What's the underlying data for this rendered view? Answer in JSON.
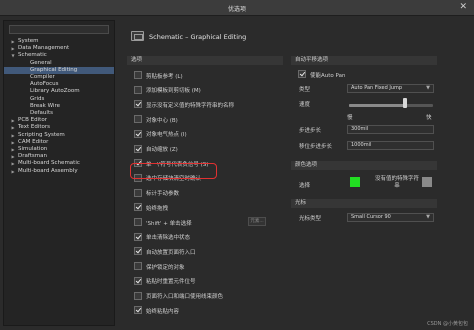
{
  "window": {
    "title": "优选项",
    "close_glyph": "✕"
  },
  "sidebar": {
    "search_value": "",
    "items": [
      {
        "label": "System",
        "arrow": "▶",
        "indent": 0,
        "selected": false
      },
      {
        "label": "Data Management",
        "arrow": "▶",
        "indent": 0,
        "selected": false
      },
      {
        "label": "Schematic",
        "arrow": "▼",
        "indent": 0,
        "selected": false
      },
      {
        "label": "General",
        "arrow": "",
        "indent": 1,
        "selected": false
      },
      {
        "label": "Graphical Editing",
        "arrow": "",
        "indent": 1,
        "selected": true
      },
      {
        "label": "Compiler",
        "arrow": "",
        "indent": 1,
        "selected": false
      },
      {
        "label": "AutoFocus",
        "arrow": "",
        "indent": 1,
        "selected": false
      },
      {
        "label": "Library AutoZoom",
        "arrow": "",
        "indent": 1,
        "selected": false
      },
      {
        "label": "Grids",
        "arrow": "",
        "indent": 1,
        "selected": false
      },
      {
        "label": "Break Wire",
        "arrow": "",
        "indent": 1,
        "selected": false
      },
      {
        "label": "Defaults",
        "arrow": "",
        "indent": 1,
        "selected": false
      },
      {
        "label": "PCB Editor",
        "arrow": "▶",
        "indent": 0,
        "selected": false
      },
      {
        "label": "Text Editors",
        "arrow": "▶",
        "indent": 0,
        "selected": false
      },
      {
        "label": "Scripting System",
        "arrow": "▶",
        "indent": 0,
        "selected": false
      },
      {
        "label": "CAM Editor",
        "arrow": "▶",
        "indent": 0,
        "selected": false
      },
      {
        "label": "Simulation",
        "arrow": "▶",
        "indent": 0,
        "selected": false
      },
      {
        "label": "Draftsman",
        "arrow": "▶",
        "indent": 0,
        "selected": false
      },
      {
        "label": "Multi-board Schematic",
        "arrow": "▶",
        "indent": 0,
        "selected": false
      },
      {
        "label": "Multi-board Assembly",
        "arrow": "▶",
        "indent": 0,
        "selected": false
      }
    ]
  },
  "header": {
    "title": "Schematic – Graphical Editing",
    "icon": "schematic-icon"
  },
  "options_section": {
    "title": "选项",
    "items": [
      {
        "label": "剪贴板参考 (L)",
        "checked": false
      },
      {
        "label": "添加模板到剪切板 (M)",
        "checked": false
      },
      {
        "label": "显示没有定义值的特殊字符串的名称",
        "checked": true
      },
      {
        "label": "对象中心 (B)",
        "checked": false
      },
      {
        "label": "对象电气热点 (I)",
        "checked": true
      },
      {
        "label": "自动缩放 (Z)",
        "checked": true
      },
      {
        "label": "单一\\'符号代表负信号 (S)",
        "checked": true
      },
      {
        "label": "选中存储块清空时确认",
        "checked": false
      },
      {
        "label": "标计手动参数",
        "checked": false
      },
      {
        "label": "始终拖拽",
        "checked": true
      },
      {
        "label": "'Shift' + 单击选择",
        "checked": false,
        "button": "元素..."
      },
      {
        "label": "单击清除选中状态",
        "checked": true
      },
      {
        "label": "自动放置页面符入口",
        "checked": true
      },
      {
        "label": "保护锁定的对象",
        "checked": false
      },
      {
        "label": "粘贴时重置元件位号",
        "checked": true
      },
      {
        "label": "页面符入口和端口使用线束颜色",
        "checked": false
      },
      {
        "label": "始终粘贴内容",
        "checked": true
      }
    ]
  },
  "autopan": {
    "title": "自动平移选项",
    "enable_label": "使能Auto Pan",
    "enable_checked": true,
    "type_label": "类型",
    "type_value": "Auto Pan Fixed Jump",
    "speed_label": "速度",
    "speed_slow": "慢",
    "speed_fast": "快",
    "speed_fraction": 0.67,
    "step_label": "步进步长",
    "step_value": "300mil",
    "shift_step_label": "移位步进步长",
    "shift_step_value": "1000mil"
  },
  "color_options": {
    "title": "颜色选项",
    "select_label": "选择",
    "select_color": "#22dd22",
    "no_value_label": "没有值的特殊字符串",
    "no_value_color": "#8a8a8a"
  },
  "cursor": {
    "title": "光标",
    "type_label": "光标类型",
    "type_value": "Small Cursor 90"
  },
  "watermark": "CSDN @小黄包包"
}
